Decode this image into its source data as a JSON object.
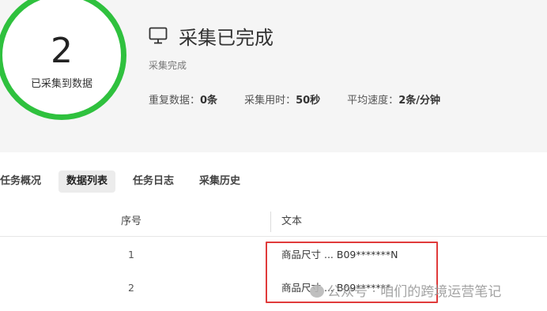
{
  "summary": {
    "count": "2",
    "count_label": "已采集到数据",
    "title": "采集已完成",
    "subtitle": "采集完成",
    "stats": {
      "duplicates_label": "重复数据：",
      "duplicates_value": "0条",
      "elapsed_label": "采集用时：",
      "elapsed_value": "50秒",
      "speed_label": "平均速度：",
      "speed_value": "2条/分钟"
    },
    "ring_color": "#2fc13e"
  },
  "tabs": [
    {
      "label": "任务概况"
    },
    {
      "label": "数据列表"
    },
    {
      "label": "任务日志"
    },
    {
      "label": "采集历史"
    }
  ],
  "table": {
    "headers": {
      "index": "序号",
      "text": "文本"
    },
    "rows": [
      {
        "index": "1",
        "text": "商品尺寸 ... B09*******N"
      },
      {
        "index": "2",
        "text": "商品尺寸 ... B09*******"
      }
    ]
  },
  "watermark": "公众号 · 咱们的跨境运营笔记",
  "highlight_color": "#e03b3b"
}
